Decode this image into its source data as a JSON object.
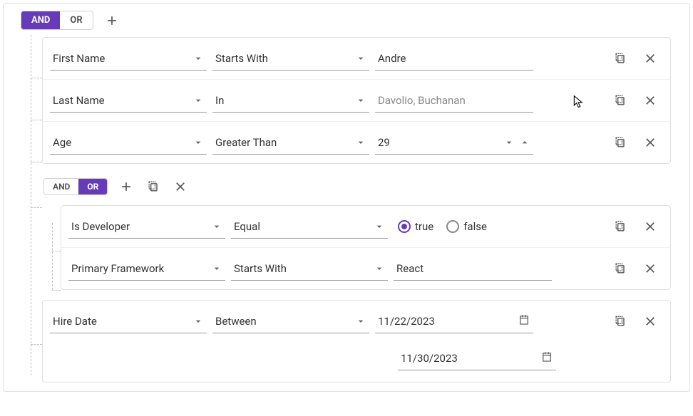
{
  "colors": {
    "accent": "#673ab7"
  },
  "root": {
    "and": "AND",
    "or": "OR"
  },
  "rules": [
    {
      "field": "First Name",
      "op": "Starts With",
      "value": "Andre"
    },
    {
      "field": "Last Name",
      "op": "In",
      "placeholder": "Davolio, Buchanan"
    },
    {
      "field": "Age",
      "op": "Greater Than",
      "value": "29"
    }
  ],
  "sub": {
    "and": "AND",
    "or": "OR",
    "rules": [
      {
        "field": "Is Developer",
        "op": "Equal",
        "radio": {
          "true": "true",
          "false": "false"
        }
      },
      {
        "field": "Primary Framework",
        "op": "Starts With",
        "value": "React"
      }
    ]
  },
  "hire": {
    "field": "Hire Date",
    "op": "Between",
    "date1": "11/22/2023",
    "date2": "11/30/2023"
  }
}
